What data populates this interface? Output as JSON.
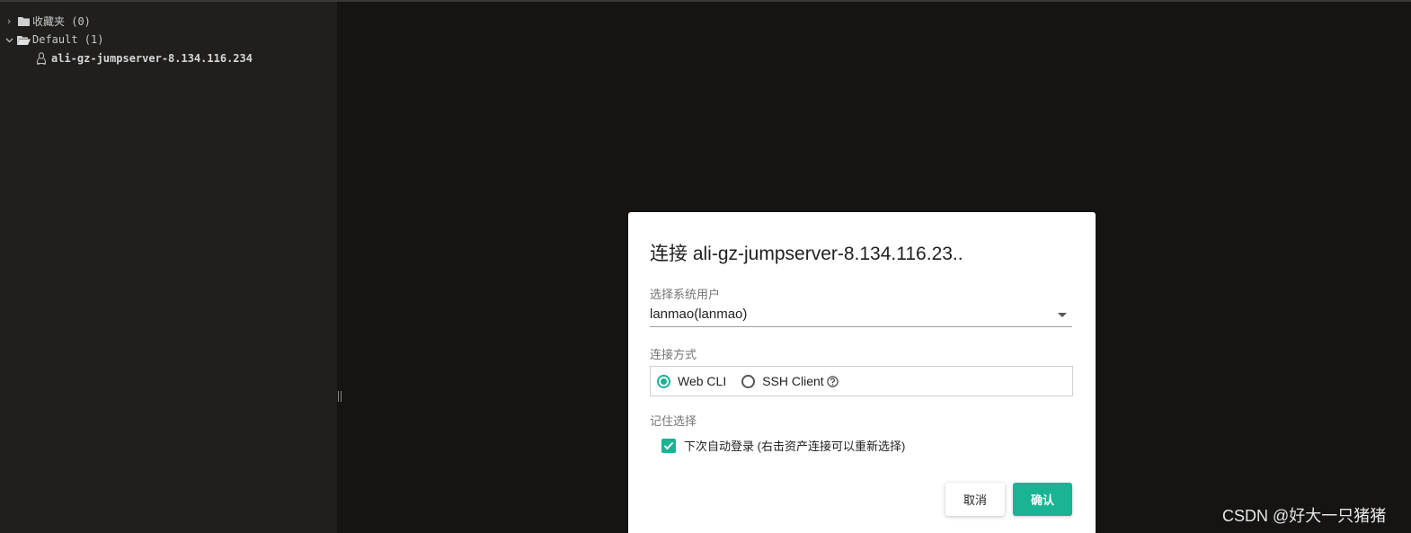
{
  "sidebar": {
    "favorites": {
      "label": "收藏夹 (0)",
      "chevron": ">",
      "icon": "folder-icon"
    },
    "default_group": {
      "label": "Default (1)",
      "chevron": "v",
      "icon": "folder-open-icon"
    },
    "host": {
      "label": "ali-gz-jumpserver-8.134.116.234",
      "icon": "linux-icon"
    }
  },
  "dialog": {
    "title": "连接 ali-gz-jumpserver-8.134.116.23..",
    "system_user_label": "选择系统用户",
    "system_user_value": "lanmao(lanmao)",
    "connect_method_label": "连接方式",
    "options": [
      {
        "label": "Web CLI",
        "selected": true
      },
      {
        "label": "SSH Client",
        "selected": false
      }
    ],
    "remember_label": "记住选择",
    "auto_login_label": "下次自动登录 (右击资产连接可以重新选择)",
    "auto_login_checked": true,
    "cancel_label": "取消",
    "confirm_label": "确认"
  },
  "colors": {
    "accent": "#1ab394",
    "sidebar_bg": "#201f1e",
    "main_bg": "#151413"
  },
  "watermark": "CSDN @好大一只猪猪"
}
